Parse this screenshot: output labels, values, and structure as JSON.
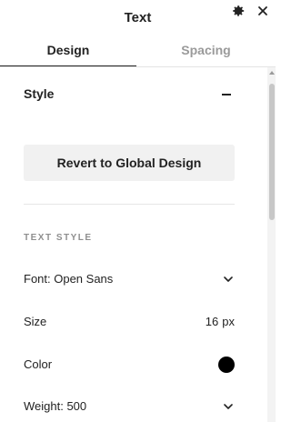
{
  "header": {
    "title": "Text",
    "gear_icon": "gear-icon",
    "close_icon": "close-icon"
  },
  "tabs": [
    {
      "label": "Design",
      "active": true
    },
    {
      "label": "Spacing",
      "active": false
    }
  ],
  "style_section": {
    "title": "Style",
    "collapse_icon": "minus-icon",
    "revert_button_label": "Revert to Global Design"
  },
  "text_style": {
    "section_label": "TEXT STYLE",
    "font_label": "Font: Open Sans",
    "size_label": "Size",
    "size_value": "16",
    "size_unit": "px",
    "color_label": "Color",
    "color_value": "#000000",
    "weight_label": "Weight: 500"
  }
}
